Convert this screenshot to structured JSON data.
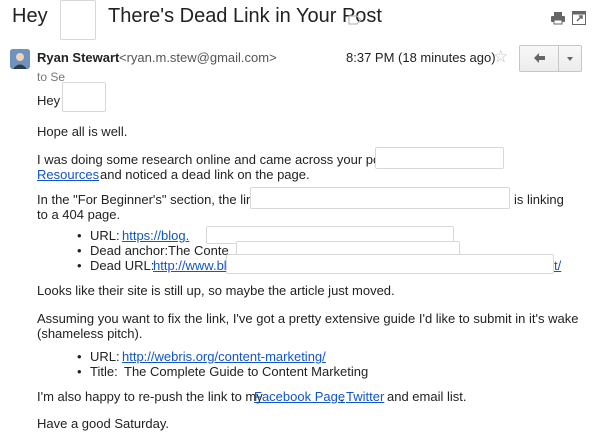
{
  "subject": {
    "hey": "Hey",
    "title": "There's Dead Link in Your Post"
  },
  "sender": {
    "name": "Ryan Stewart",
    "email": "<ryan.m.stew@gmail.com>",
    "time": "8:37 PM (18 minutes ago)",
    "to": "to Se"
  },
  "body": {
    "greeting": "Hey",
    "p1": "Hope all is well.",
    "p2_line1": "I was doing some research online and came across your post",
    "p2_link": "Resources",
    "p2_line2": "and noticed a dead link on the page.",
    "p3_line1_a": "In the \"For Beginner's\" section, the link",
    "p3_line1_b": "is linking",
    "p3_line2": "to a 404 page.",
    "dead_list": {
      "url_label": "URL:",
      "url_link": "https://blog.",
      "anchor_label": "Dead anchor:",
      "anchor_text": "The Conte",
      "dead_url_label": "Dead URL:",
      "dead_url_link": "http://www.bl",
      "dead_url_tail": "t/"
    },
    "p4": "Looks like their site is still up, so maybe the article just moved.",
    "p5_line1": "Assuming you want to fix the link, I've got a pretty extensive guide I'd like to submit in it's wake",
    "p5_line2": "(shameless pitch).",
    "my_list": {
      "url_label": "URL:",
      "url_link": "http://webris.org/content-marketing/",
      "title_label": "Title:",
      "title_text": "The Complete Guide to Content Marketing"
    },
    "p6_a": "I'm also happy to re-push the link to my",
    "p6_link1": "Facebook Page",
    "p6_comma": ",",
    "p6_link2": "Twitter",
    "p6_b": "and email list.",
    "p7": "Have a good Saturday."
  },
  "colors": {
    "link": "#1155cc",
    "text": "#222222",
    "muted": "#777777"
  },
  "icons": [
    "label-icon",
    "print-icon",
    "new-window-icon",
    "star-icon",
    "reply-icon",
    "dropdown-icon"
  ]
}
